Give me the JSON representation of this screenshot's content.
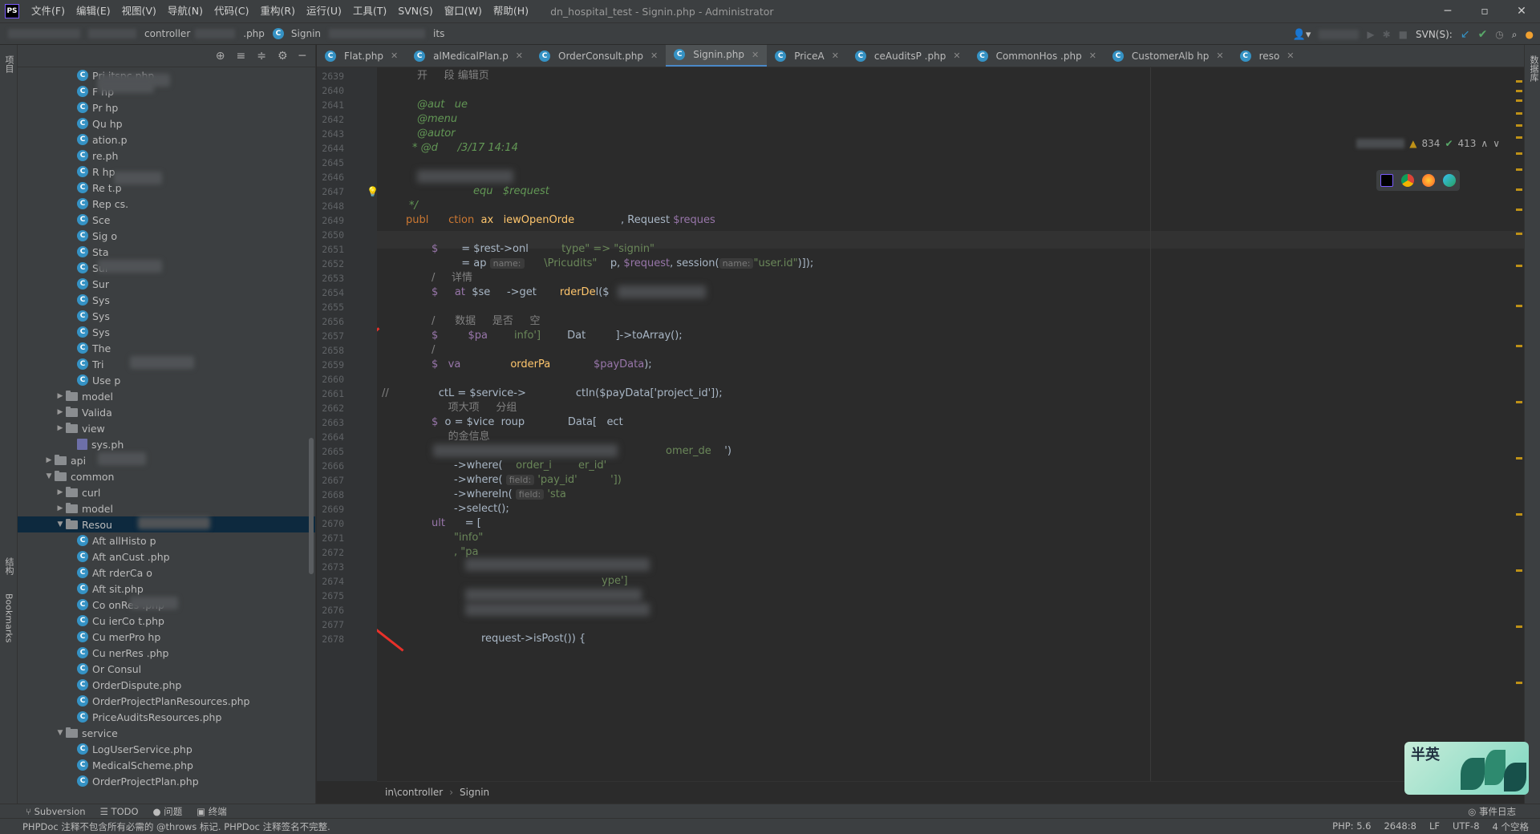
{
  "menu": [
    "文件(F)",
    "编辑(E)",
    "视图(V)",
    "导航(N)",
    "代码(C)",
    "重构(R)",
    "运行(U)",
    "工具(T)",
    "SVN(S)",
    "窗口(W)",
    "帮助(H)"
  ],
  "window_title": "dn_hospital_test - Signin.php - Administrator",
  "app_logo": "PS",
  "navbar": {
    "crumbs": [
      "controller",
      ".php",
      "Signin"
    ],
    "crumb_tail": "its",
    "svn_label": "SVN(S):"
  },
  "left_stripe": {
    "project": "项目",
    "structure": "结构",
    "bookmarks": "Bookmarks"
  },
  "right_stripe": {
    "database": "数据库"
  },
  "tree": {
    "rows": [
      {
        "type": "class",
        "label": "Pri   itspc.php",
        "indent": 5
      },
      {
        "type": "class",
        "label": "F      hp",
        "indent": 5
      },
      {
        "type": "class",
        "label": "Pr      hp",
        "indent": 5
      },
      {
        "type": "class",
        "label": "Qu      hp",
        "indent": 5
      },
      {
        "type": "class",
        "label": "      ation.p",
        "indent": 5
      },
      {
        "type": "class",
        "label": "        re.ph",
        "indent": 5
      },
      {
        "type": "class",
        "label": "R        hp",
        "indent": 5
      },
      {
        "type": "class",
        "label": "Re         t.p",
        "indent": 5
      },
      {
        "type": "class",
        "label": "Rep      cs.",
        "indent": 5
      },
      {
        "type": "class",
        "label": "Sce      ",
        "indent": 5
      },
      {
        "type": "class",
        "label": "Sig       o",
        "indent": 5
      },
      {
        "type": "class",
        "label": "Sta",
        "indent": 5
      },
      {
        "type": "class",
        "label": "Sur",
        "indent": 5
      },
      {
        "type": "class",
        "label": "Sur",
        "indent": 5
      },
      {
        "type": "class",
        "label": "Sys",
        "indent": 5
      },
      {
        "type": "class",
        "label": "Sys",
        "indent": 5
      },
      {
        "type": "class",
        "label": "Sys",
        "indent": 5
      },
      {
        "type": "class",
        "label": "The",
        "indent": 5
      },
      {
        "type": "class",
        "label": "Tri",
        "indent": 5
      },
      {
        "type": "class",
        "label": "Use    p",
        "indent": 5
      },
      {
        "type": "folder",
        "label": "model",
        "indent": 4,
        "arrow": "▶"
      },
      {
        "type": "folder",
        "label": "Valida",
        "indent": 4,
        "arrow": "▶"
      },
      {
        "type": "folder",
        "label": "view",
        "indent": 4,
        "arrow": "▶"
      },
      {
        "type": "php",
        "label": "sys.ph",
        "indent": 5
      },
      {
        "type": "folder",
        "label": "api",
        "indent": 3,
        "arrow": "▶"
      },
      {
        "type": "folder",
        "label": "common",
        "indent": 3,
        "arrow": "▼"
      },
      {
        "type": "folder",
        "label": "curl",
        "indent": 4,
        "arrow": "▶"
      },
      {
        "type": "folder",
        "label": "model",
        "indent": 4,
        "arrow": "▶"
      },
      {
        "type": "folder",
        "label": "Resou",
        "indent": 4,
        "arrow": "▼",
        "selected": true
      },
      {
        "type": "class",
        "label": "Aft    allHisto     p",
        "indent": 5
      },
      {
        "type": "class",
        "label": "Aft    anCust     .php",
        "indent": 5
      },
      {
        "type": "class",
        "label": "Aft    rderCa     o",
        "indent": 5
      },
      {
        "type": "class",
        "label": "Aft    sit.php",
        "indent": 5
      },
      {
        "type": "class",
        "label": "Co     onRes     .php",
        "indent": 5
      },
      {
        "type": "class",
        "label": "Cu     ierCo      t.php",
        "indent": 5
      },
      {
        "type": "class",
        "label": "Cu     merPro     hp",
        "indent": 5
      },
      {
        "type": "class",
        "label": "Cu     nerRes     .php",
        "indent": 5
      },
      {
        "type": "class",
        "label": "Or    Consul",
        "indent": 5
      },
      {
        "type": "class",
        "label": "OrderDispute.php",
        "indent": 5
      },
      {
        "type": "class",
        "label": "OrderProjectPlanResources.php",
        "indent": 5
      },
      {
        "type": "class",
        "label": "PriceAuditsResources.php",
        "indent": 5
      },
      {
        "type": "folder",
        "label": "service",
        "indent": 4,
        "arrow": "▼"
      },
      {
        "type": "class",
        "label": "LogUserService.php",
        "indent": 5
      },
      {
        "type": "class",
        "label": "MedicalScheme.php",
        "indent": 5
      },
      {
        "type": "class",
        "label": "OrderProjectPlan.php",
        "indent": 5
      }
    ]
  },
  "tabs": [
    {
      "label": "Flat.php",
      "active": false
    },
    {
      "label": "alMedicalPlan.p",
      "active": false
    },
    {
      "label": "OrderConsult.php",
      "active": false
    },
    {
      "label": "Signin.php",
      "active": true
    },
    {
      "label": "PriceA",
      "active": false
    },
    {
      "label": "ceAuditsP      .php",
      "active": false
    },
    {
      "label": "CommonHos        .php",
      "active": false
    },
    {
      "label": "CustomerAlb      hp",
      "active": false
    },
    {
      "label": "reso",
      "active": false
    }
  ],
  "inspection": {
    "warnings": "834",
    "ok": "413"
  },
  "line_numbers": [
    "2639",
    "2640",
    "2641",
    "2642",
    "2643",
    "2644",
    "2645",
    "2646",
    "2647",
    "2648",
    "2649",
    "2650",
    "2651",
    "2652",
    "2653",
    "2654",
    "2655",
    "2656",
    "2657",
    "2658",
    "2659",
    "2660",
    "2661",
    "2662",
    "2663",
    "2664",
    "2665",
    "2666",
    "2667",
    "2668",
    "2669",
    "2670",
    "2671",
    "2672",
    "2673",
    "2674",
    "2675",
    "2676",
    "2677",
    "2678"
  ],
  "code": {
    "l2639": "开     段 编辑页",
    "l2641": "@aut   ue",
    "l2642": "@menu",
    "l2643": "@autor",
    "l2644": "* @d      /3/17 14:14",
    "l2647_tail": "equ   $request",
    "l2648": "*/",
    "l2649_kw": "publ",
    "l2649_b": "ction",
    "l2649_c": "ax",
    "l2649_d": "iewOpenOrde",
    "l2649_e": ", Request ",
    "l2649_f": "$reques",
    "l2651_a": "$",
    "l2651_b": "= $r",
    "l2651_c": "est->onl",
    "l2651_d": "type\" => \"signin\"",
    "l2652_a": "= ap",
    "l2652_hint": "name:",
    "l2652_b": "\\Pric",
    "l2652_c": "udits\"",
    "l2652_d": "p, ",
    "l2652_e": "$request",
    "l2652_f": ", session(",
    "l2652_hint2": "name:",
    "l2652_g": "\"user.id\"",
    "l2652_h": ")]);",
    "l2653": "/     详情",
    "l2654_a": "$     at",
    "l2654_b": "$se     ->get",
    "l2654_c": "rderDe",
    "l2654_d": "l($",
    "l2656": "/      数据     是否     空",
    "l2657_a": "$",
    "l2657_b": "$pa",
    "l2657_c": "info'] ",
    "l2657_d": "Dat",
    "l2657_e": "]->toArray();",
    "l2658": "/       ",
    "l2659_a": "$   va",
    "l2659_b": "orderPa",
    "l2659_c": "$payData",
    "l2659_d": ");",
    "l2661_cmt": "//",
    "l2661_a": "ctL",
    "l2661_b": " = $service->",
    "l2661_c": "ctIn($payData['project_id']);",
    "l2662": "     项大项     分组",
    "l2663_a": "$",
    "l2663_b": "o = $",
    "l2663_c": "vice",
    "l2663_d": "roup",
    "l2663_e": "Data[",
    "l2663_f": "ect",
    "l2664": "     的金信息",
    "l2665_a": "omer_de",
    "l2665_b": "')",
    "l2666_a": "->where(",
    "l2666_b": "order_i",
    "l2666_c": "er_id'",
    "l2667_a": "->where(",
    "l2667_hint": "field:",
    "l2667_b": "'pay_id'",
    "l2667_c": "'])",
    "l2668_a": "->whereIn(",
    "l2668_hint": "field:",
    "l2668_b": "'sta",
    "l2669": "->select();",
    "l2670_a": "ult",
    "l2670_b": "= [",
    "l2671": "\"info\"",
    "l2672": ", \"pa",
    "l2674": "ype']",
    "l2678": "request->isPost()) {"
  },
  "editor_breadcrumb": [
    "in\\controller",
    "Signin"
  ],
  "bottom_tools": [
    "Subversion",
    "TODO",
    "问题",
    "终端"
  ],
  "event_log": "事件日志",
  "status": {
    "message": "PHPDoc 注释不包含所有必需的 @throws 标记. PHPDoc 注释签名不完整.",
    "php": "PHP: 5.6",
    "position": "2648:8",
    "line_sep": "LF",
    "encoding": "UTF-8",
    "indent": "4 个空格"
  },
  "mascot": {
    "text": "半英"
  },
  "colors": {
    "accent": "#4a88c7",
    "keyword": "#cc7832",
    "variable": "#9876aa",
    "string": "#6a8759",
    "arrow": "#e8312a"
  }
}
